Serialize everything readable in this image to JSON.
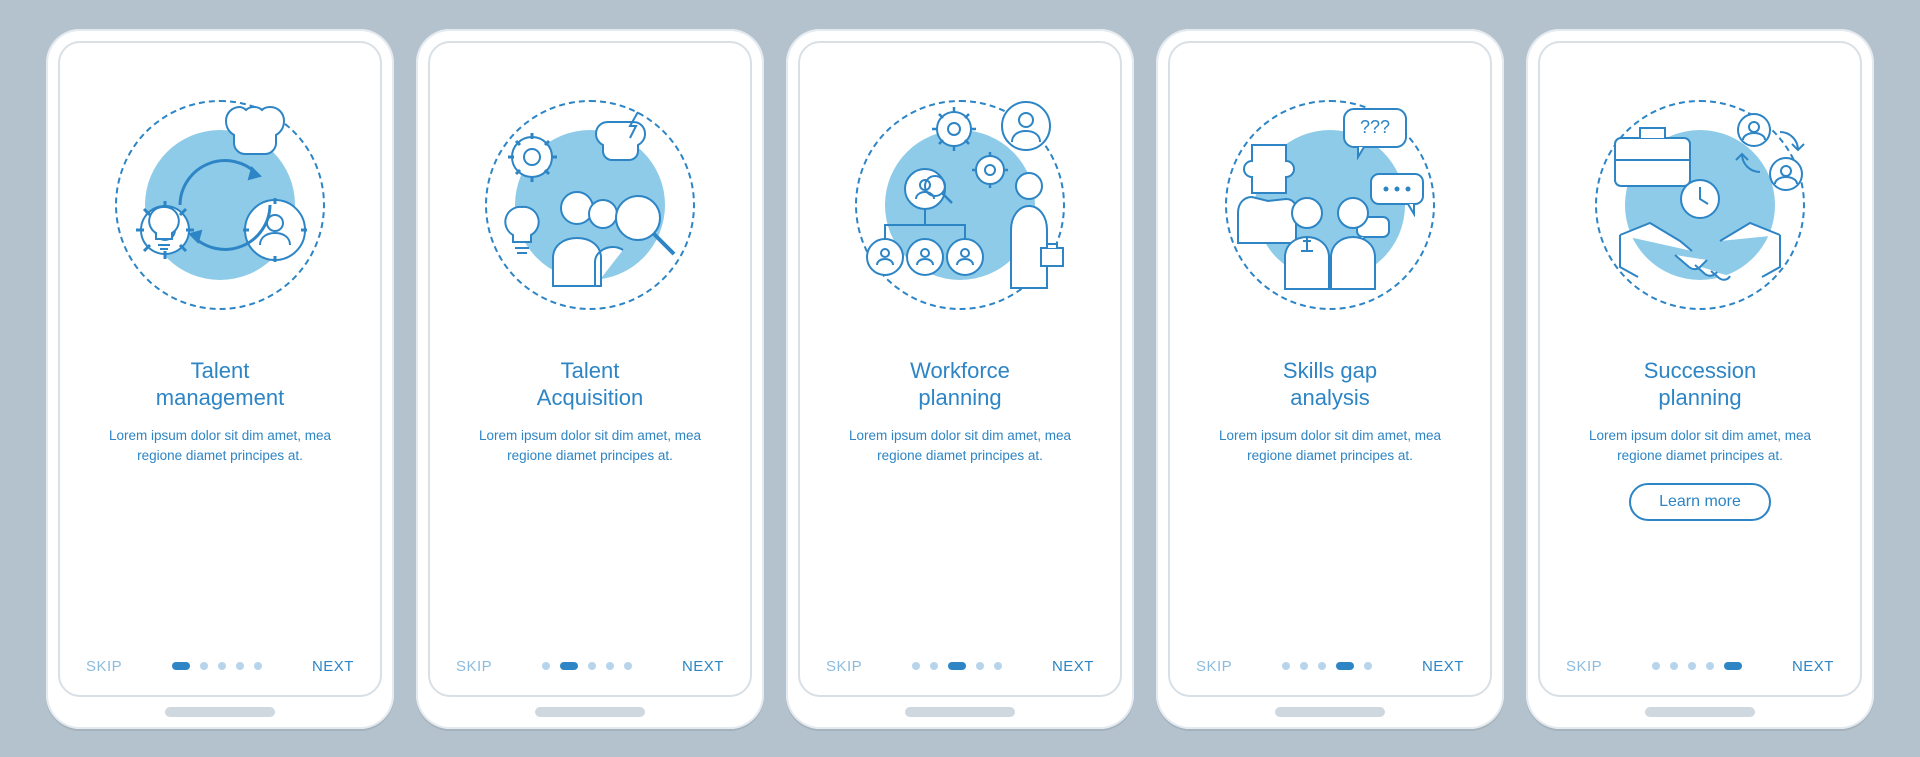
{
  "common": {
    "skip": "SKIP",
    "next": "NEXT",
    "desc": "Lorem ipsum dolor sit dim amet, mea regione diamet principes at."
  },
  "screens": [
    {
      "title": "Talent\nmanagement",
      "active": 0,
      "cta": null
    },
    {
      "title": "Talent\nAcquisition",
      "active": 1,
      "cta": null
    },
    {
      "title": "Workforce\nplanning",
      "active": 2,
      "cta": null
    },
    {
      "title": "Skills gap\nanalysis",
      "active": 3,
      "cta": null
    },
    {
      "title": "Succession\nplanning",
      "active": 4,
      "cta": "Learn more"
    }
  ],
  "colors": {
    "primary": "#2d85c5",
    "accent": "#8dcbe8",
    "bg": "#b3c2cc"
  }
}
